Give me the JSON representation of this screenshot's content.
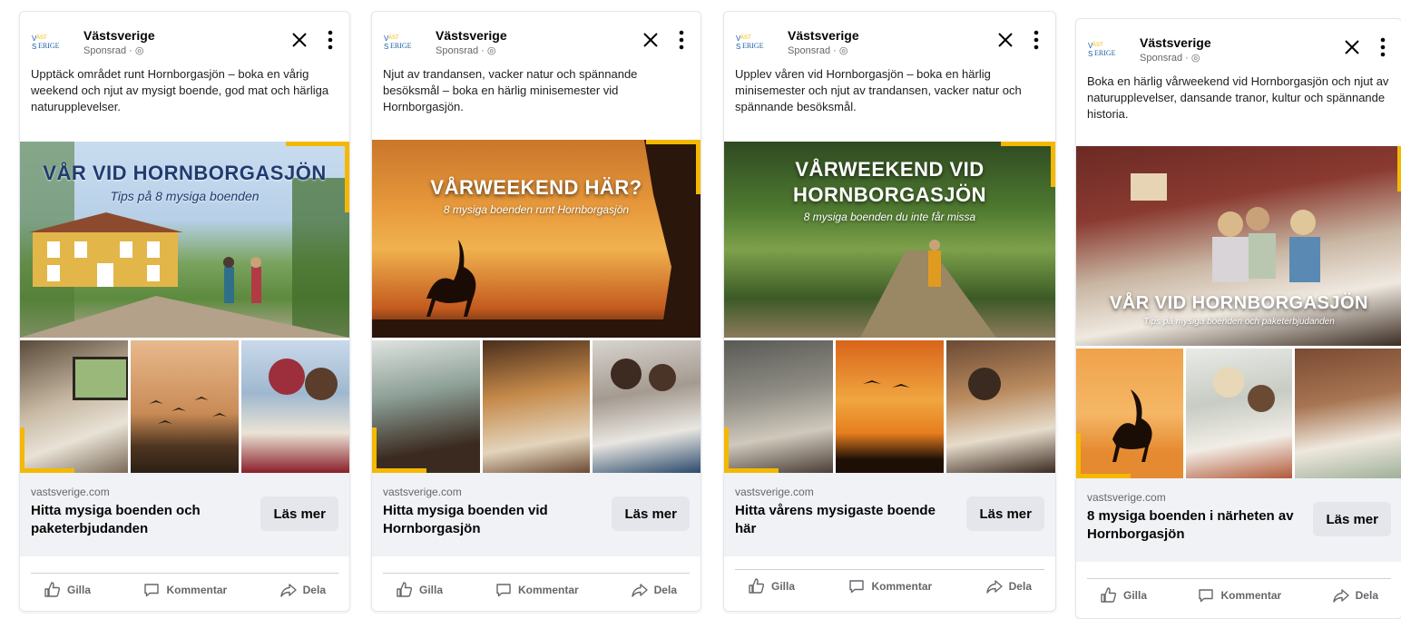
{
  "colors": {
    "accent_yellow": "#f5b800",
    "footer_bg": "#f0f2f5",
    "button_bg": "#e4e6eb",
    "text_primary": "#050505",
    "text_secondary": "#65676b"
  },
  "icons": [
    "vastsverige-logo-icon",
    "close-icon",
    "more-options-icon",
    "like-icon",
    "comment-icon",
    "share-icon",
    "globe-icon"
  ],
  "ads": [
    {
      "page_name": "Västsverige",
      "sponsored": "Sponsrad · ",
      "primary_text": "Upptäck området runt Hornborgasjön – boka en vårig weekend och njut av mysigt boende, god mat och härliga naturupplevelser.",
      "image_headline": "VÅR VID HORNBORGASJÖN",
      "image_subline": "Tips på 8 mysiga boenden",
      "domain": "vastsverige.com",
      "link_title": "Hitta mysiga boenden och paketerbjudanden",
      "cta_label": "Läs mer",
      "like_label": "Gilla",
      "comment_label": "Kommentar",
      "share_label": "Dela"
    },
    {
      "page_name": "Västsverige",
      "sponsored": "Sponsrad · ",
      "primary_text": "Njut av trandansen, vacker natur och spännande besöksmål – boka en härlig minisemester vid Hornborgasjön.",
      "image_headline": "VÅRWEEKEND HÄR?",
      "image_subline": "8 mysiga boenden runt Hornborgasjön",
      "domain": "vastsverige.com",
      "link_title": "Hitta mysiga boenden vid Hornborgasjön",
      "cta_label": "Läs mer",
      "like_label": "Gilla",
      "comment_label": "Kommentar",
      "share_label": "Dela"
    },
    {
      "page_name": "Västsverige",
      "sponsored": "Sponsrad · ",
      "primary_text": "Upplev våren vid Hornborgasjön – boka en härlig minisemester och njut av trandansen, vacker natur och spännande besöksmål.",
      "image_headline_1": "VÅRWEEKEND VID",
      "image_headline_2": "HORNBORGASJÖN",
      "image_subline": "8 mysiga boenden du inte får missa",
      "domain": "vastsverige.com",
      "link_title": "Hitta vårens mysigaste boende här",
      "cta_label": "Läs mer",
      "like_label": "Gilla",
      "comment_label": "Kommentar",
      "share_label": "Dela"
    },
    {
      "page_name": "Västsverige",
      "sponsored": "Sponsrad · ",
      "primary_text": "Boka en härlig vårweekend vid Hornborgasjön och njut av naturupplevelser, dansande tranor, kultur och spännande historia.",
      "image_headline": "VÅR VID HORNBORGASJÖN",
      "image_subline": "Tips på mysiga boenden och paketerbjudanden",
      "domain": "vastsverige.com",
      "link_title": "8 mysiga boenden i närheten av Hornborgasjön",
      "cta_label": "Läs mer",
      "like_label": "Gilla",
      "comment_label": "Kommentar",
      "share_label": "Dela"
    }
  ]
}
